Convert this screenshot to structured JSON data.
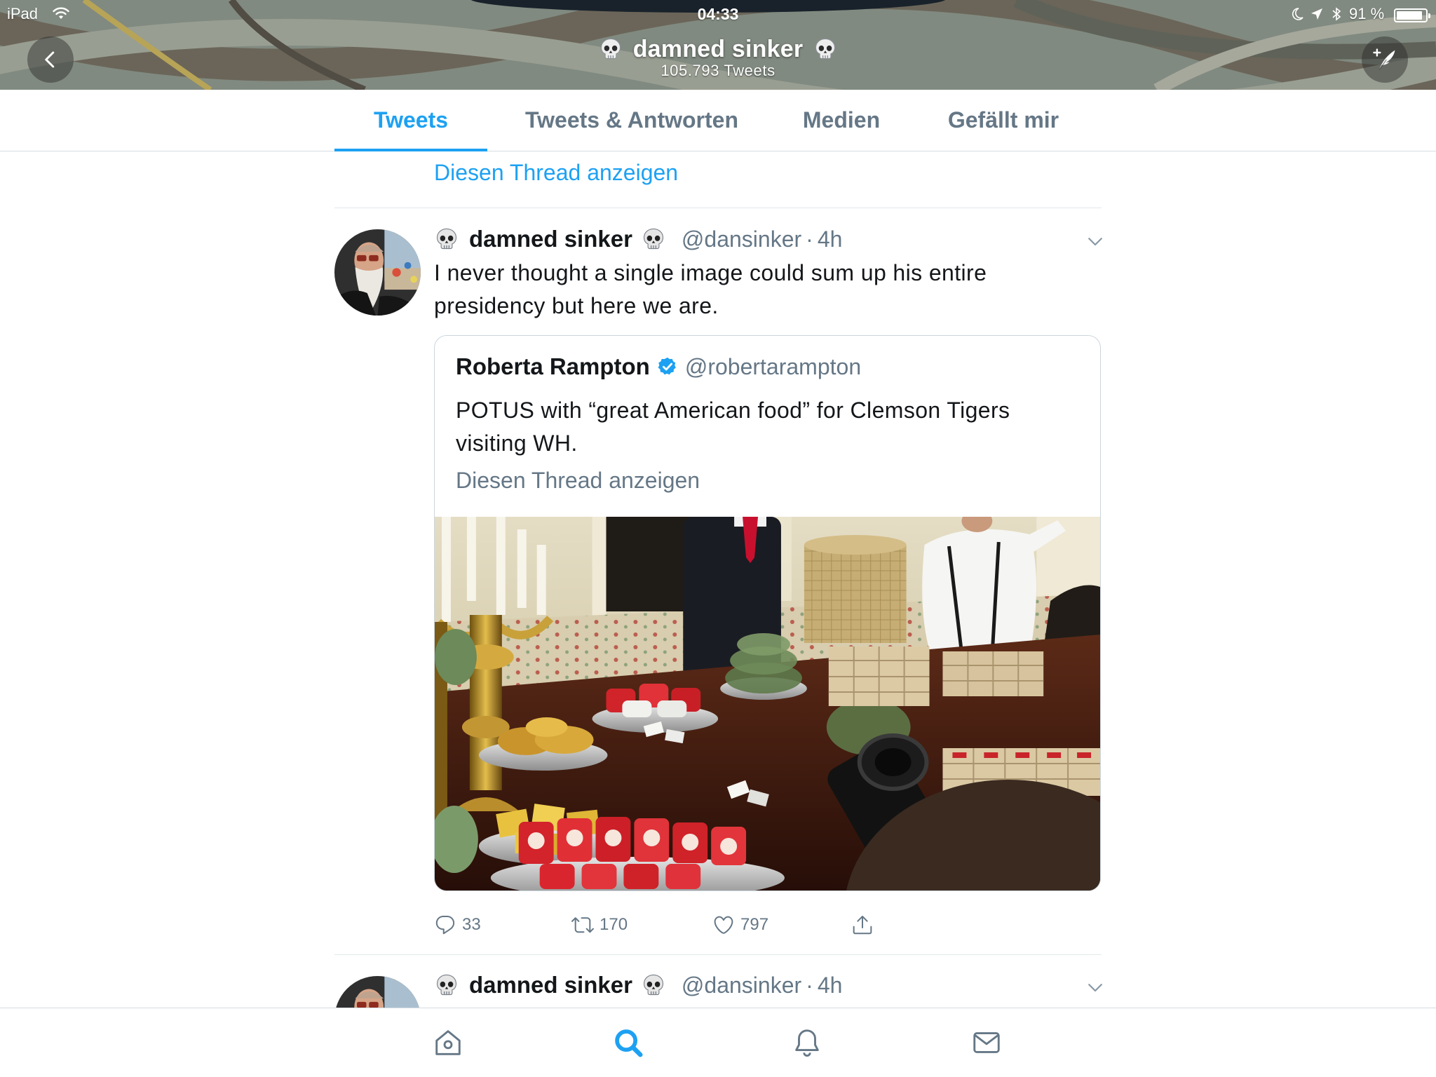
{
  "status_bar": {
    "device": "iPad",
    "time": "04:33",
    "battery": "91 %",
    "battery_fraction": 0.91,
    "icons": [
      "wifi-icon",
      "moon-icon",
      "location-arrow-icon",
      "bluetooth-icon",
      "battery-icon"
    ]
  },
  "profile_header": {
    "name": "damned sinker",
    "name_emoji": "skull-icon",
    "tweet_count": "105.793 Tweets",
    "back_icon": "chevron-left-icon",
    "compose_icon": "compose-tweet-icon"
  },
  "tabs": {
    "items": [
      {
        "label": "Tweets",
        "active": true
      },
      {
        "label": "Tweets & Antworten",
        "active": false
      },
      {
        "label": "Medien",
        "active": false
      },
      {
        "label": "Gefällt mir",
        "active": false
      }
    ]
  },
  "timeline": {
    "thread_link": "Diesen Thread anzeigen",
    "tweets": [
      {
        "author": {
          "name": "damned sinker",
          "handle": "@dansinker",
          "emoji": "skull-icon"
        },
        "separator": "·",
        "time": "4h",
        "text": "I never thought a single image could sum up his entire presidency but here we are.",
        "quote": {
          "name": "Roberta Rampton",
          "verified": true,
          "handle": "@robertarampton",
          "text": "POTUS with “great American food” for Clemson Tigers visiting WH.",
          "thread_link": "Diesen Thread anzeigen"
        },
        "actions": {
          "replies": "33",
          "retweets": "170",
          "likes": "797",
          "icons": [
            "reply-icon",
            "retweet-icon",
            "like-icon",
            "share-icon"
          ]
        }
      },
      {
        "author": {
          "name": "damned sinker",
          "handle": "@dansinker",
          "emoji": "skull-icon"
        },
        "separator": "·",
        "time": "4h"
      }
    ]
  },
  "bottom_nav": {
    "items": [
      {
        "icon": "home-icon",
        "active": false
      },
      {
        "icon": "search-icon",
        "active": true
      },
      {
        "icon": "bell-icon",
        "active": false
      },
      {
        "icon": "mail-icon",
        "active": false
      }
    ]
  },
  "colors": {
    "accent": "#1DA1F2",
    "text": "#14171A",
    "secondary": "#657786",
    "border": "#E1E8ED",
    "verified": "#1DA1F2"
  }
}
